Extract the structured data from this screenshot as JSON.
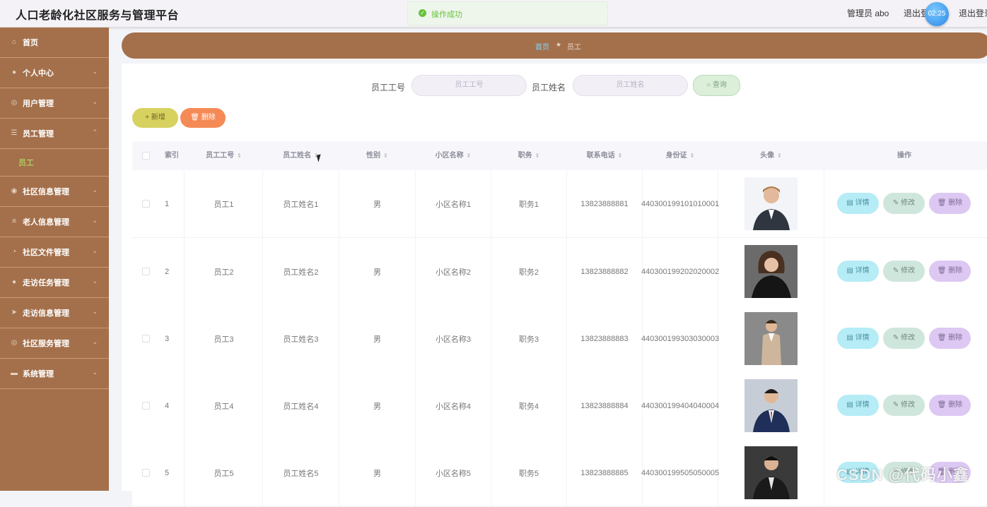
{
  "header": {
    "app_title": "人口老龄化社区服务与管理平台",
    "toast_text": "操作成功",
    "admin": "管理员 abo",
    "logout_partial": "退出登录",
    "clock": "02:25",
    "logout": "退出登录"
  },
  "sidebar": {
    "items": [
      {
        "label": "首页",
        "icon": "home-icon",
        "submenu": false
      },
      {
        "label": "个人中心",
        "icon": "user-icon",
        "submenu": true
      },
      {
        "label": "用户管理",
        "icon": "users-icon",
        "submenu": true
      },
      {
        "label": "员工管理",
        "icon": "list-icon",
        "submenu": true,
        "children": [
          "员工"
        ]
      },
      {
        "label": "社区信息管理",
        "icon": "info-icon",
        "submenu": true
      },
      {
        "label": "老人信息管理",
        "icon": "menu-icon",
        "submenu": true
      },
      {
        "label": "社区文件管理",
        "icon": "file-icon",
        "submenu": true
      },
      {
        "label": "走访任务管理",
        "icon": "task-icon",
        "submenu": true
      },
      {
        "label": "走访信息管理",
        "icon": "send-icon",
        "submenu": true
      },
      {
        "label": "社区服务管理",
        "icon": "service-icon",
        "submenu": true
      },
      {
        "label": "系统管理",
        "icon": "settings-icon",
        "submenu": true
      }
    ]
  },
  "breadcrumb": {
    "home": "首页",
    "separator": "★",
    "current": "员工"
  },
  "search": {
    "emp_no_label": "员工工号",
    "emp_no_placeholder": "员工工号",
    "emp_name_label": "员工姓名",
    "emp_name_placeholder": "员工姓名",
    "query_label": "查询"
  },
  "actions": {
    "add_label": "新增",
    "delete_label": "删除"
  },
  "table": {
    "columns": [
      "索引",
      "员工工号",
      "员工姓名",
      "性别",
      "小区名称",
      "职务",
      "联系电话",
      "身份证",
      "头像",
      "操作"
    ],
    "ops": {
      "detail": "详情",
      "edit": "修改",
      "delete": "删除"
    },
    "rows": [
      {
        "index": "1",
        "emp_no": "员工1",
        "emp_name": "员工姓名1",
        "gender": "男",
        "community": "小区名称1",
        "position": "职务1",
        "phone": "13823888881",
        "id_card": "440300199101010001"
      },
      {
        "index": "2",
        "emp_no": "员工2",
        "emp_name": "员工姓名2",
        "gender": "男",
        "community": "小区名称2",
        "position": "职务2",
        "phone": "13823888882",
        "id_card": "440300199202020002"
      },
      {
        "index": "3",
        "emp_no": "员工3",
        "emp_name": "员工姓名3",
        "gender": "男",
        "community": "小区名称3",
        "position": "职务3",
        "phone": "13823888883",
        "id_card": "440300199303030003"
      },
      {
        "index": "4",
        "emp_no": "员工4",
        "emp_name": "员工姓名4",
        "gender": "男",
        "community": "小区名称4",
        "position": "职务4",
        "phone": "13823888884",
        "id_card": "440300199404040004"
      },
      {
        "index": "5",
        "emp_no": "员工5",
        "emp_name": "员工姓名5",
        "gender": "男",
        "community": "小区名称5",
        "position": "职务5",
        "phone": "13823888885",
        "id_card": "440300199505050005"
      }
    ]
  },
  "watermark": "CSDN @代码小鑫"
}
